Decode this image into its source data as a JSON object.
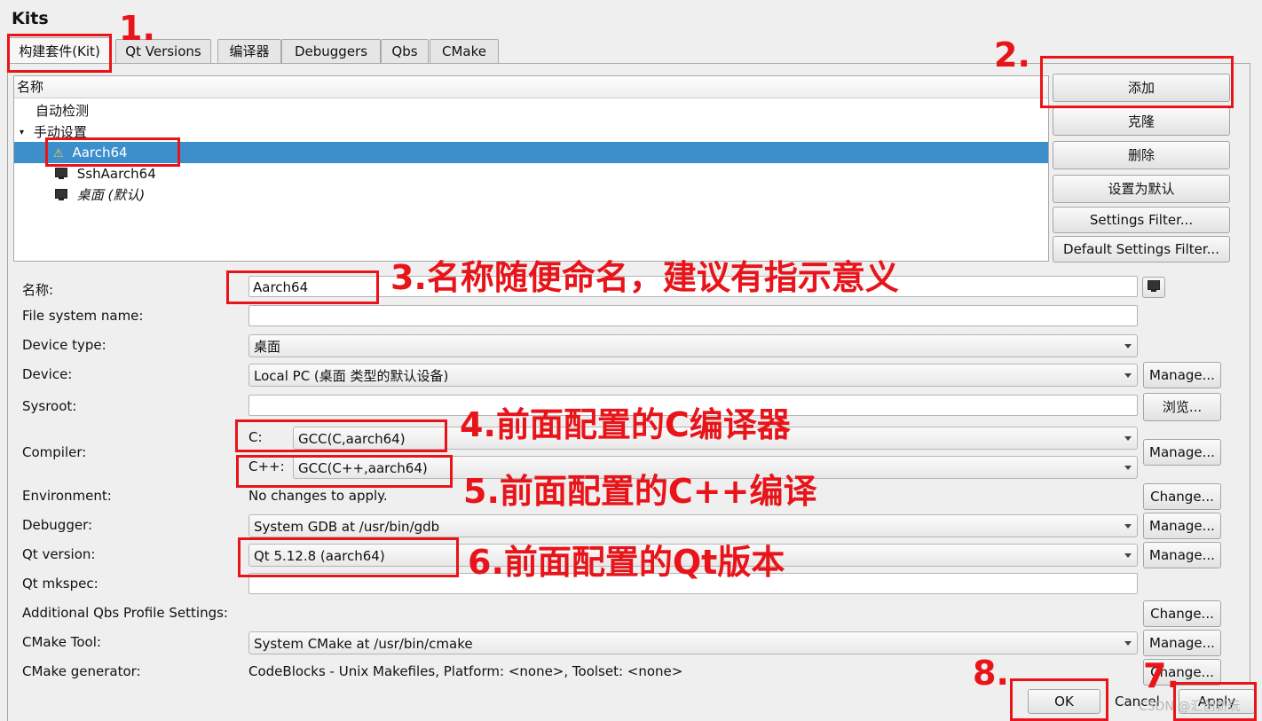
{
  "window_title": "Kits",
  "tabs": [
    "构建套件(Kit)",
    "Qt Versions",
    "编译器",
    "Debuggers",
    "Qbs",
    "CMake"
  ],
  "tree": {
    "header": "名称",
    "items": {
      "auto": "自动检测",
      "manual": "手动设置",
      "aarch64": "Aarch64",
      "ssh": "SshAarch64",
      "desktop": "桌面 (默认)"
    }
  },
  "side_buttons": {
    "add": "添加",
    "clone": "克隆",
    "delete": "删除",
    "make_default": "设置为默认",
    "settings_filter": "Settings Filter...",
    "default_settings_filter": "Default Settings Filter..."
  },
  "form": {
    "name_label": "名称:",
    "name_value": "Aarch64",
    "fs_name_label": "File system name:",
    "fs_name_value": "",
    "device_type_label": "Device type:",
    "device_type_value": "桌面",
    "device_label": "Device:",
    "device_value": "Local PC (桌面 类型的默认设备)",
    "device_btn": "Manage...",
    "sysroot_label": "Sysroot:",
    "sysroot_btn": "浏览...",
    "compiler_label": "Compiler:",
    "c_label": "C:",
    "c_value": "GCC(C,aarch64)",
    "cpp_label": "C++:",
    "cpp_value": "GCC(C++,aarch64)",
    "compiler_btn": "Manage...",
    "env_label": "Environment:",
    "env_value": "No changes to apply.",
    "env_btn": "Change...",
    "debugger_label": "Debugger:",
    "debugger_value": "System GDB at /usr/bin/gdb",
    "debugger_btn": "Manage...",
    "qtver_label": "Qt version:",
    "qtver_value": "Qt 5.12.8 (aarch64)",
    "qtver_btn": "Manage...",
    "mkspec_label": "Qt mkspec:",
    "qbs_label": "Additional Qbs Profile Settings:",
    "qbs_btn": "Change...",
    "cmake_label": "CMake Tool:",
    "cmake_value": "System CMake at /usr/bin/cmake",
    "cmake_btn": "Manage...",
    "cmake_gen_label": "CMake generator:",
    "cmake_gen_value": "CodeBlocks - Unix Makefiles, Platform: <none>, Toolset: <none>",
    "cmake_gen_btn": "Change..."
  },
  "footer": {
    "ok": "OK",
    "cancel": "Cancel",
    "apply": "Apply"
  },
  "annotations": {
    "a1": "1.",
    "a2": "2.",
    "a3": "3.名称随便命名，建议有指示意义",
    "a4": "4.前面配置的C编译器",
    "a5": "5.前面配置的C++编译",
    "a6": "6.前面配置的Qt版本",
    "a7": "7.",
    "a8": "8."
  },
  "watermark": "CSDN @汇创新玩",
  "colors": {
    "annotation": "#e8141a",
    "selection": "#3d8fcc"
  }
}
